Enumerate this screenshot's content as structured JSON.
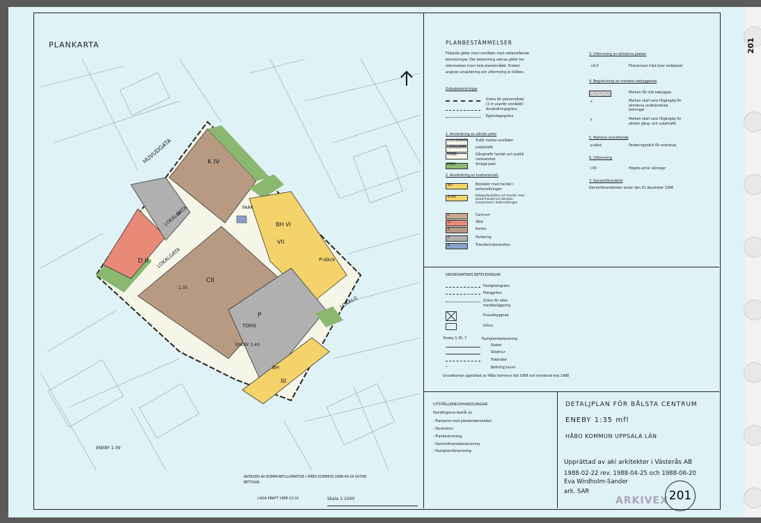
{
  "map_title": "PLANKARTA",
  "map_labels": [
    {
      "text": "HUVUDGATA"
    },
    {
      "text": "LOKALGATA"
    },
    {
      "text": "LOKALGATA"
    },
    {
      "text": "TORG"
    },
    {
      "text": "K IV"
    },
    {
      "text": "P"
    },
    {
      "text": "D II"
    },
    {
      "text": "CII"
    },
    {
      "text": "VII"
    },
    {
      "text": "BH VI"
    },
    {
      "text": "P-däck"
    },
    {
      "text": "P"
    },
    {
      "text": "III"
    },
    {
      "text": "BH"
    },
    {
      "text": "1:35"
    },
    {
      "text": "ENEBY 1:40"
    },
    {
      "text": "ENEBY 1:39"
    },
    {
      "text": "PARK"
    },
    {
      "text": "LOKALG"
    }
  ],
  "scale_text": "Skala 1:1000",
  "adoption": {
    "line1": "ANTAGEN AV KOMMUNFULLMÄKTIGE I HÅBO KOMMUN 1988-09-26 §47/88",
    "line2": "BETYGAR:",
    "line3": "LAGA KRAFT 1988-10-22"
  },
  "planbestammelser": {
    "title": "PLANBESTÄMMELSER",
    "intro": [
      "Följande gäller inom områden med nedanstående",
      "beteckningar. Där beteckning saknas gäller be-",
      "stämmelsen inom hela planområdet. Endast",
      "angiven användning och utformning är tillåten."
    ],
    "grans_title": "Gränsbeteckningar",
    "grans": [
      "Gräns för planområdet (3 m utanför området)",
      "Användningsgräns",
      "Egenskapsgräns"
    ],
    "s1_title": "1.   Användning av allmän plats",
    "s1": [
      {
        "code": "HUVUDGATA",
        "text": "Trafik mellan områden"
      },
      {
        "code": "LOKALGATA",
        "text": "Lokaltrafik"
      },
      {
        "code": "TORG",
        "text": "Gångtrafik handel och publik verksamhet"
      },
      {
        "code": "PARK",
        "text": "Anlagd park"
      }
    ],
    "s2_title": "2.   Användning av kvartersmark",
    "s2": [
      {
        "code": "BH",
        "color": "#f3d36a",
        "text": "Bostäder med handel i bottenvåningen"
      },
      {
        "code": "B-KH",
        "color": "#f3d36a",
        "text": "Kategoriboställen och handel, med kontor/handel och bostads-komplement i bottenvåningen"
      },
      {
        "code": "C",
        "color": "#c9a98a",
        "text": "Centrum"
      },
      {
        "code": "D",
        "color": "#e98978",
        "text": "Vård"
      },
      {
        "code": "K",
        "color": "#b89a82",
        "text": "Kontor"
      },
      {
        "code": "P",
        "color": "#b0b0b0",
        "text": "Parkering"
      },
      {
        "code": "E",
        "color": "#8aa0c8",
        "text": "Transformatorstation"
      }
    ],
    "s3_title": "3.   Utformning av allmänna platser",
    "s3": [
      {
        "code": "+0,0",
        "text": "Föreskriven höjd över nollplanet"
      }
    ],
    "s4_title": "4.   Begränsning av markens bebyggande",
    "s4": [
      {
        "code": "",
        "text": "Marken får inte bebyggas"
      },
      {
        "code": "x",
        "text": "Marken skall vara tillgänglig för allmänna underjordiska ledningar"
      },
      {
        "code": "z",
        "text": "Marken skall vara tillgänglig för allmän gång- och cykeltrafik"
      }
    ],
    "s5_title": "5.   Markens anordnande",
    "s5": [
      {
        "code": "p-däck",
        "text": "Parkeringsdäck får anordnas"
      }
    ],
    "s6_title": "6.   Utformning",
    "s6": [
      {
        "code": "I-VII",
        "text": "Högsta antal våningar"
      }
    ],
    "s7_title": "7.   Genomförandetid",
    "s7_text": "Genomförandetiden slutar den 31 december 1998"
  },
  "grundkarta": {
    "title": "GRUNDKARTANS BETECKNINGAR",
    "items": [
      "Fastighetsgräns",
      "Planggräns",
      "Gräns för olika markbeläggning",
      "Huvudbyggnad",
      "Uthus"
    ],
    "items2": [
      "Fastighetsbeteckning",
      "Staket",
      "Stödmur",
      "Trädrader",
      "Befintlig brunn"
    ],
    "eneby": "Eneby  1:35, 7",
    "footer": "Grundkartan upprättad av Håbo kommun feb 1988 och reviderad maj 1988"
  },
  "utstallning": {
    "title": "UTSTÄLLNINGSHANDLINGAR",
    "intro": "Handlingarna består av",
    "items": [
      "- Plankarta med planbestämmelser",
      "- Illustration",
      "- Planbeskrivning",
      "- Genomförandebeskrivning",
      "- Fastighetsförteckning"
    ]
  },
  "title_block": {
    "plan": "DETALJPLAN FÖR BÅLSTA CENTRUM",
    "area": "ENEBY   1:35 mfl",
    "municipality": "HÅBO KOMMUN  UPPSALA LÄN",
    "prepared": "Upprättad av aki arkitekter i Västerås  AB",
    "dates": "1988-02-22       rev.  1988-04-25 och  1988-06-20",
    "architect": "Eva  Wirdholm-Sander",
    "title": "ark.  SAR",
    "logo": "ARKIVEX",
    "sheet_no": "201"
  },
  "page_number": "201"
}
